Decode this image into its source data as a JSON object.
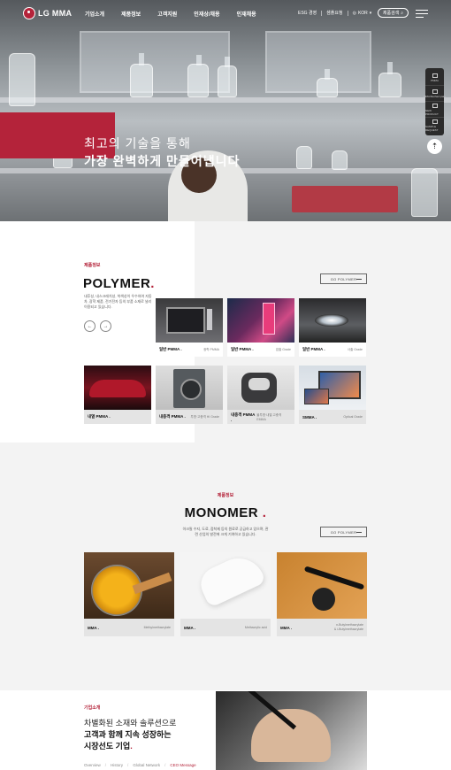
{
  "header": {
    "logo_text": "LG MMA",
    "nav": [
      "기업소개",
      "제품정보",
      "고객지원",
      "인재상/채용",
      "인재채용"
    ],
    "util": [
      "ESG 경영",
      "샘플요청",
      "KOR"
    ],
    "search_label": "제품검색"
  },
  "hero": {
    "line1": "최고의 기술을 통해",
    "line2": "가장 완벽하게 만들어냅니다"
  },
  "quick_menu": [
    "PMMA",
    "MMA/Methacrylate",
    "NEW PRODUCT",
    "SAMPLE REQUEST"
  ],
  "polymer": {
    "eyebrow": "제품정보",
    "title": "POLYMER",
    "title_dot": ".",
    "description": "내후성, 내스크래치성, 착색성이 우수하여 자동차, 광학 제품, 전기전자 등의 부품 소재로 널리 이용되고 있습니다.",
    "go_button": "GO POLYMER",
    "cards": [
      {
        "name": "일반 PMMA .",
        "grade": "광학 PMMA"
      },
      {
        "name": "일반 PMMA .",
        "grade": "압출 Grade"
      },
      {
        "name": "일반 PMMA .",
        "grade": "사출 Grade"
      },
      {
        "name": "내열 PMMA .",
        "grade": ""
      },
      {
        "name": "내충격 PMMA .",
        "grade": "투명·고충격 HI Grade"
      },
      {
        "name": "내충격 PMMA .",
        "grade": "불투명·내열 고충격 EMMA"
      },
      {
        "name": "SMMA .",
        "grade": "Optical Grade"
      }
    ]
  },
  "monomer": {
    "eyebrow": "제품정보",
    "title": "MONOMER",
    "title_dot": ".",
    "description": "아크릴 수지, 도료, 접착제 등의 원료로 공급하고 있으며, 관련 산업의 발전에 크게 기여하고 있습니다.",
    "go_button": "GO POLYMER",
    "cards": [
      {
        "name": "MMA .",
        "grade": "Methylmethacrylate"
      },
      {
        "name": "MMA .",
        "grade": "Methacrylic acid"
      },
      {
        "name": "MMA .",
        "grade_line1": "n-Butylmethacrylate",
        "grade_line2": "& i-Butylmethacrylate"
      }
    ]
  },
  "about": {
    "eyebrow": "기업소개",
    "line1": "차별화된 소재와 솔루션으로",
    "line2": "고객과 함께 지속 성장하는",
    "line3": "시장선도 기업",
    "dot": ".",
    "nav": [
      "Overview",
      "History",
      "Global Network",
      "CEO Message"
    ]
  },
  "colors": {
    "brand_red": "#b4233a",
    "dark": "#111111",
    "panel_gray": "#e4e4e4"
  }
}
